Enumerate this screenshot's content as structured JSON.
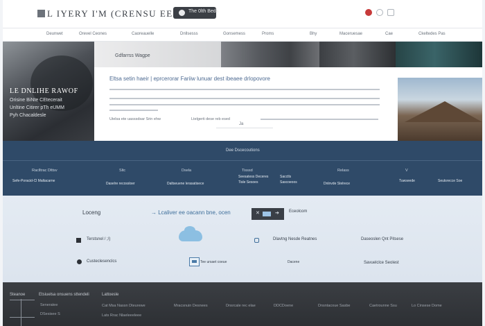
{
  "header": {
    "logo_text": "L IYERY I'M (CRENSU EEJDE)",
    "pill_label": "The 0lth Beds"
  },
  "nav": {
    "items": [
      "Deunwet",
      "Orevel Ceones",
      "Caoreauelle",
      "Dnllsesss",
      "Gonsemess",
      "Proms",
      "Bhy",
      "Maceruesae",
      "Cae",
      "Ckeltedes Pas"
    ]
  },
  "hero": {
    "title": "LE DNLIHE RAWOF",
    "lines": [
      "Orisine BiNte CEtecerait",
      "Unltine Citirer pTh eUMM",
      "Pyh Chacaldesle"
    ],
    "strip_title": "Gdfarrss Wagpe"
  },
  "article": {
    "title": "Eltsa setin haeir | eprcerorar Fariiw lunuar dest ibeaee drlopovore",
    "link1": "Uielsa ete uasssdsar Srin ehw",
    "link2": "Ltelgerti dese reb esed",
    "more": "Ja"
  },
  "band": {
    "title": "Dee Dscecoutions",
    "labels": [
      "Raclltrac Dlttsv",
      "Sltc",
      "Dsela",
      "Tisssd",
      "Relass",
      "V"
    ],
    "values": [
      "Sefe-Poracid-Cl Maltacarne",
      "Daselre recossloer",
      "Daltseuene lerasatisece",
      "Seesatess Deceres",
      "Sacctls",
      "Tisle Sesoes",
      "Dnlnvde Stelrece",
      "Sascoeoos",
      "Tuwseede",
      "Seutsrecce Soe"
    ]
  },
  "mid": {
    "label_left": "Loceng",
    "headline": "→ Lcaliver ee oacann bne, ocen",
    "action_label": "Eceolcom",
    "row1_left": "Terstsnel / ;/)",
    "row1_right": "Dlavtng Nesde Reatnes",
    "row1_far": "Daseoslen  Qnt  Pitsese",
    "row2_left": "Custeclesenclcs",
    "row2_mid": "Tee ursaet coeue",
    "row2_right": "Dacene",
    "row2_far": "Savuelclce Seolest"
  },
  "footer": {
    "col1": [
      "Steanoe",
      "Seneratee",
      "DSesisee   S"
    ],
    "col2": [
      "Etsiuelsa onsuens sttendeli"
    ],
    "col3": [
      "Lattoesle",
      "Cat Msa Nassn Dteurewe",
      "Lats Rrac Nlaeleeeleee"
    ],
    "row": [
      "Mracsnuin Desnees",
      "Dnsrcale rec elae",
      "DDCDoene",
      "Dnsntacoue Sasbe",
      "Caetrounne Ssu",
      "Lo  Cinsese Dome"
    ]
  },
  "colors": {
    "band": "#2f4a68",
    "accent_red": "#c73a3a",
    "article_title": "#4d6a91",
    "footer": "#35383d"
  }
}
